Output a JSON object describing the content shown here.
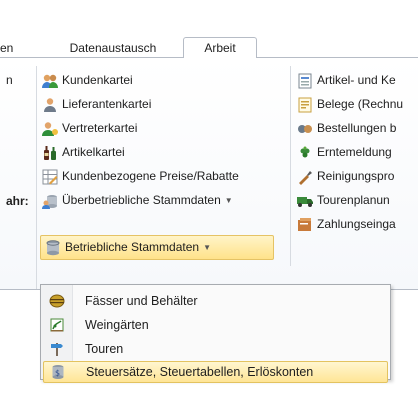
{
  "tabs": {
    "partial": "en",
    "datenaustausch": "Datenaustausch",
    "arbeit": "Arbeit"
  },
  "left_fragments": {
    "top": "n",
    "label": "ahr:"
  },
  "ribbon": {
    "col1": [
      {
        "label": "Kundenkartei",
        "icon": "customers-icon"
      },
      {
        "label": "Lieferantenkartei",
        "icon": "supplier-icon"
      },
      {
        "label": "Vertreterkartei",
        "icon": "representative-icon"
      },
      {
        "label": "Artikelkartei",
        "icon": "bottles-icon"
      },
      {
        "label": "Kundenbezogene Preise/Rabatte",
        "icon": "price-table-icon"
      },
      {
        "label": "Überbetriebliche Stammdaten",
        "icon": "database-shared-icon",
        "has_arrow": true
      },
      {
        "label": "Betriebliche Stammdaten",
        "icon": "database-icon",
        "has_arrow": true,
        "active": true
      }
    ],
    "col2": [
      {
        "label": "Artikel- und Ke",
        "icon": "article-icon"
      },
      {
        "label": "Belege (Rechnu",
        "icon": "document-icon"
      },
      {
        "label": "Bestellungen b",
        "icon": "orders-icon"
      },
      {
        "label": "Erntemeldung",
        "icon": "grape-icon"
      },
      {
        "label": "Reinigungspro",
        "icon": "brush-icon"
      },
      {
        "label": "Tourenplanun",
        "icon": "truck-icon"
      },
      {
        "label": "Zahlungseinga",
        "icon": "payment-icon"
      }
    ]
  },
  "dropdown": {
    "items": [
      {
        "label": "Fässer und Behälter",
        "icon": "barrel-icon"
      },
      {
        "label": "Weingärten",
        "icon": "vineyard-icon"
      },
      {
        "label": "Touren",
        "icon": "signpost-icon"
      },
      {
        "label": "Steuersätze, Steuertabellen, Erlöskonten",
        "icon": "tax-database-icon",
        "selected": true
      }
    ]
  },
  "colors": {
    "highlight": "#ffe28a",
    "highlight_border": "#e5c365",
    "separator": "#b6bcc6"
  }
}
